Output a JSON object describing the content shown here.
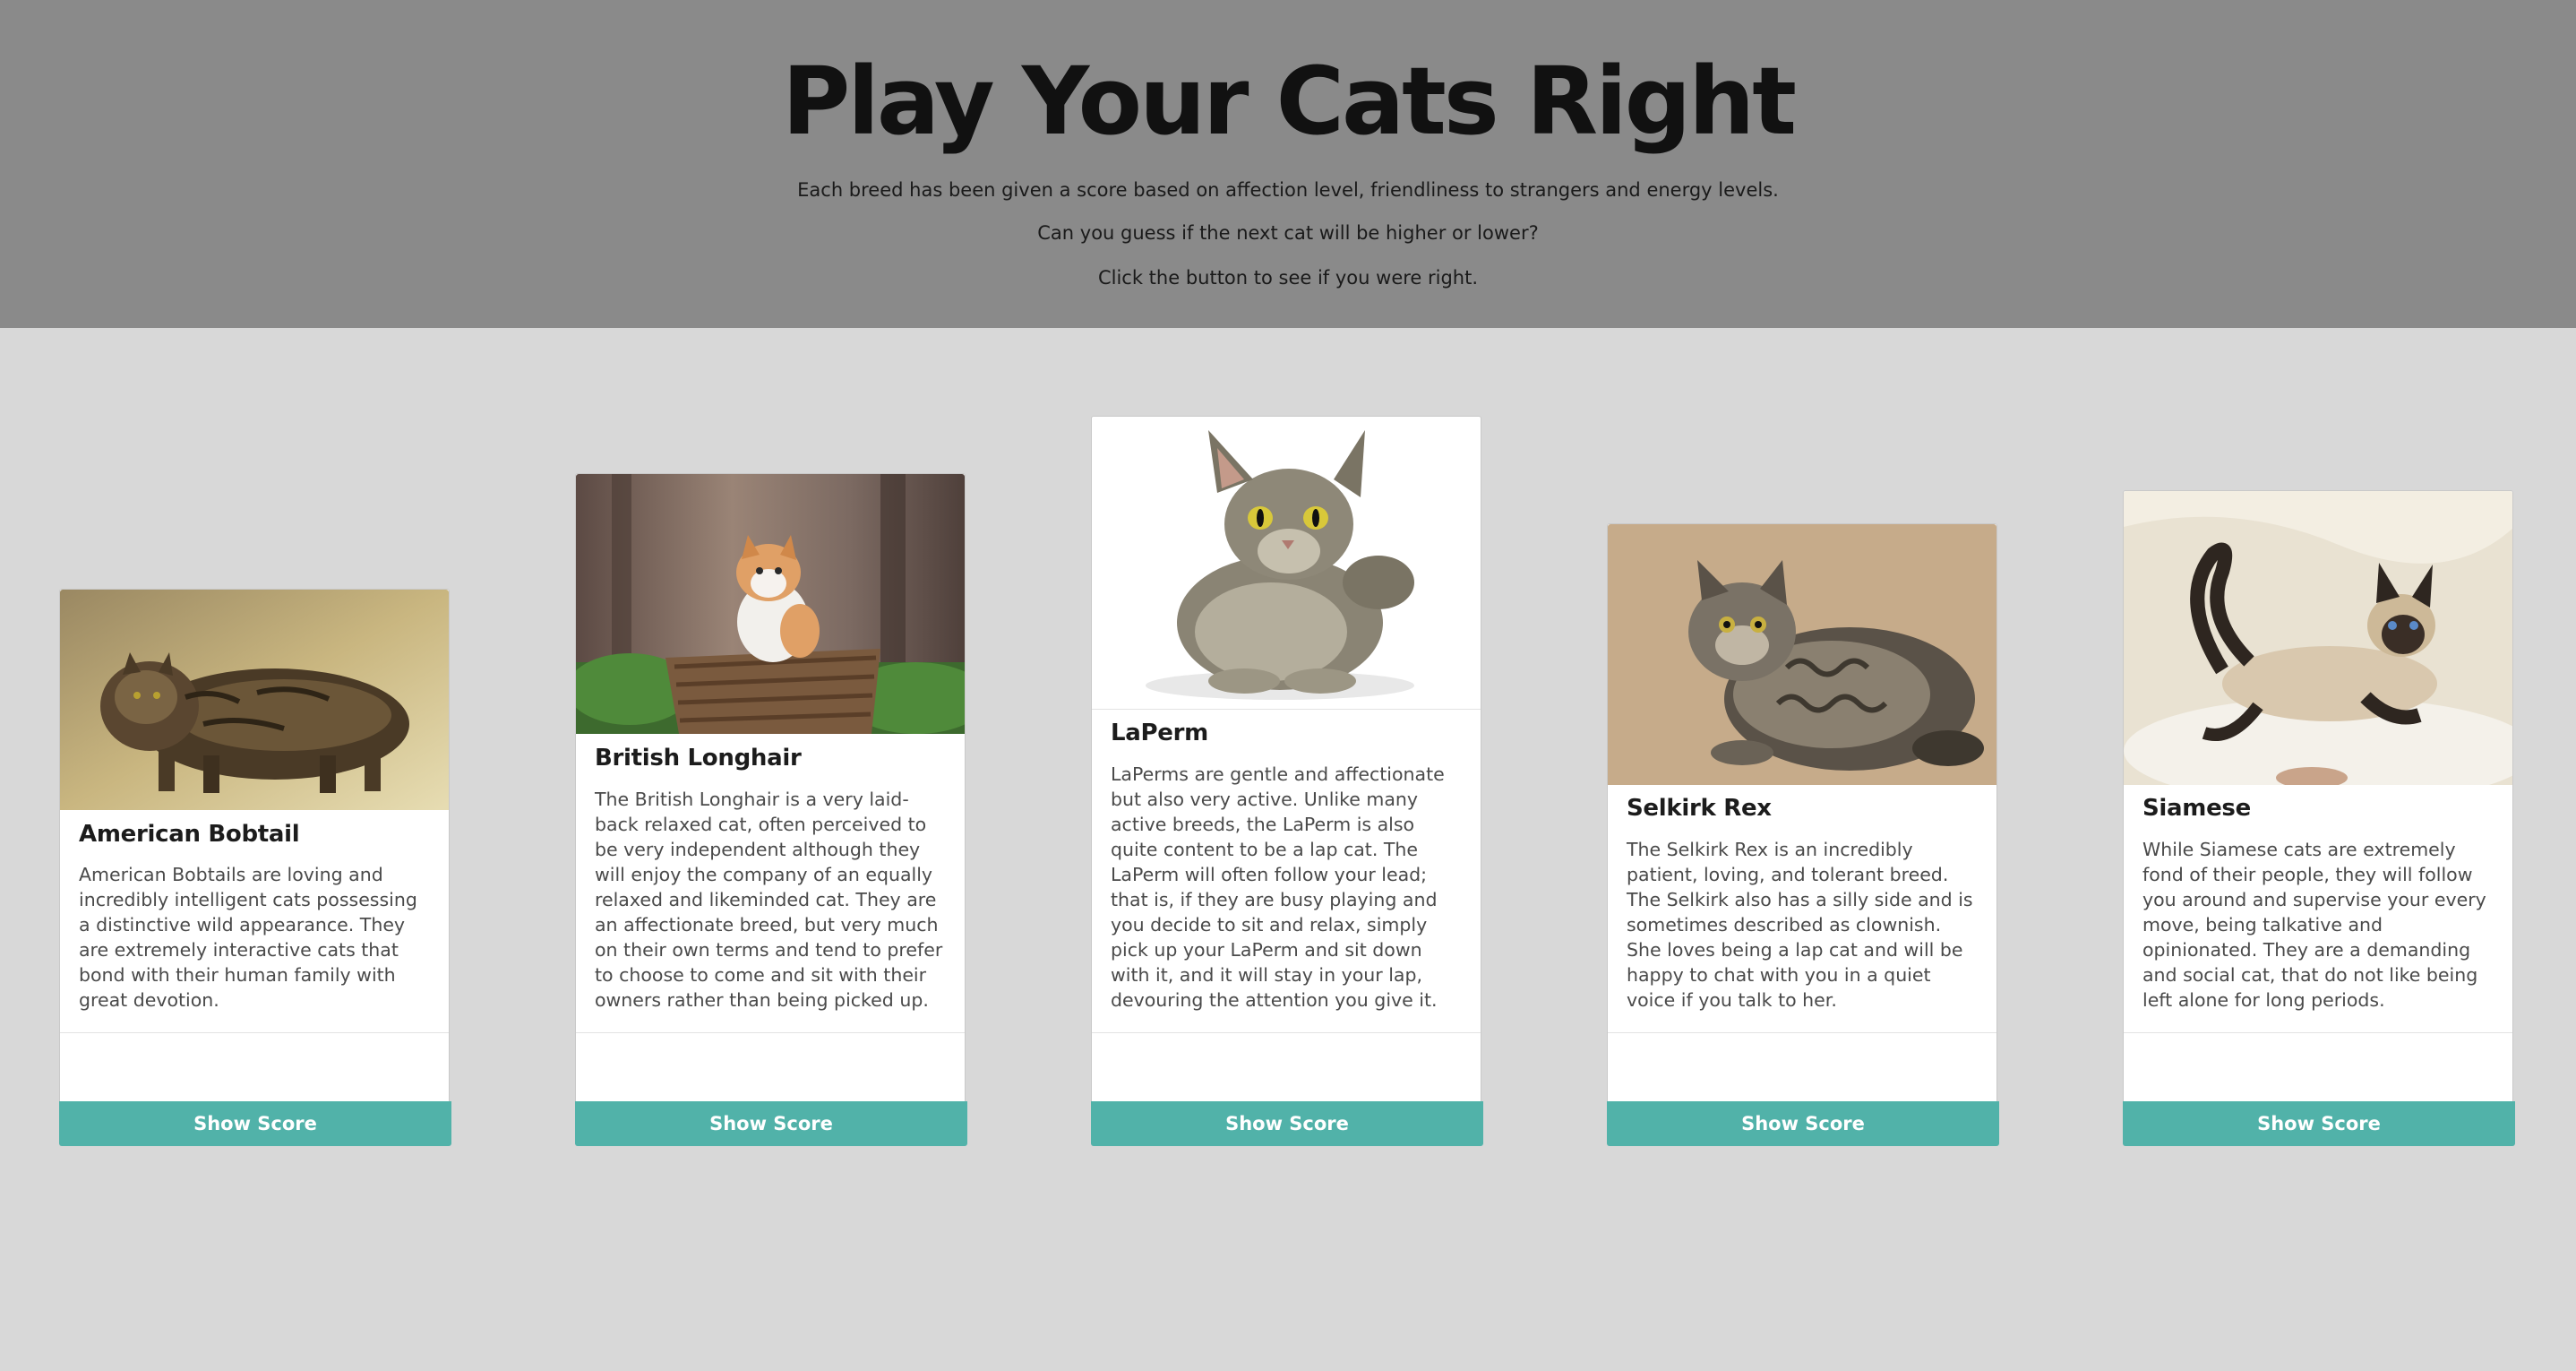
{
  "header": {
    "title": "Play Your Cats Right",
    "intro_1": "Each breed has been given a score based on affection level, friendliness to strangers and energy levels.",
    "intro_2": "Can you guess if the next cat will be higher or lower?",
    "intro_3": "Click the button to see if you were right."
  },
  "colors": {
    "hero_bg": "#8a8a8a",
    "page_bg": "#d8d8d8",
    "button_bg": "#51b2a9"
  },
  "cards": [
    {
      "name": "American Bobtail",
      "description": "American Bobtails are loving and incredibly intelligent cats possessing a distinctive wild appearance. They are extremely interactive cats that bond with their human family with great devotion.",
      "button_label": "Show Score",
      "image_icon": "tabby-cat-photo"
    },
    {
      "name": "British Longhair",
      "description": "The British Longhair is a very laid-back relaxed cat, often perceived to be very independent although they will enjoy the company of an equally relaxed and likeminded cat. They are an affectionate breed, but very much on their own terms and tend to prefer to choose to come and sit with their owners rather than being picked up.",
      "button_label": "Show Score",
      "image_icon": "kitten-in-basket-photo"
    },
    {
      "name": "LaPerm",
      "description": "LaPerms are gentle and affectionate but also very active. Unlike many active breeds, the LaPerm is also quite content to be a lap cat. The LaPerm will often follow your lead; that is, if they are busy playing and you decide to sit and relax, simply pick up your LaPerm and sit down with it, and it will stay in your lap, devouring the attention you give it.",
      "button_label": "Show Score",
      "image_icon": "grey-cat-photo"
    },
    {
      "name": "Selkirk Rex",
      "description": "The Selkirk Rex is an incredibly patient, loving, and tolerant breed. The Selkirk also has a silly side and is sometimes described as clownish. She loves being a lap cat and will be happy to chat with you in a quiet voice if you talk to her.",
      "button_label": "Show Score",
      "image_icon": "curly-cat-photo"
    },
    {
      "name": "Siamese",
      "description": "While Siamese cats are extremely fond of their people, they will follow you around and supervise your every move, being talkative and opinionated. They are a demanding and social cat, that do not like being left alone for long periods.",
      "button_label": "Show Score",
      "image_icon": "siamese-cat-photo"
    }
  ]
}
